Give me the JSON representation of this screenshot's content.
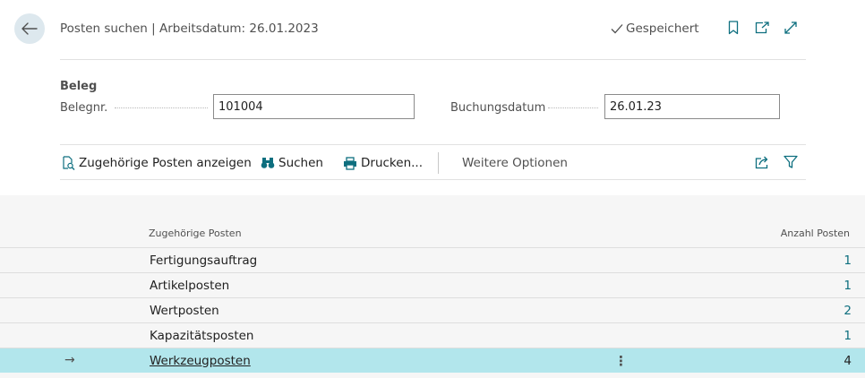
{
  "header": {
    "title": "Posten suchen | Arbeitsdatum: 26.01.2023",
    "saved_label": "Gespeichert",
    "icons": [
      "bookmark-icon",
      "open-new-window-icon",
      "expand-icon"
    ]
  },
  "form": {
    "section_label": "Beleg",
    "belegnr": {
      "label": "Belegnr.",
      "value": "101004"
    },
    "buchungsdatum": {
      "label": "Buchungsdatum",
      "value": "26.01.23"
    }
  },
  "actions": {
    "show_related": "Zugehörige Posten anzeigen",
    "search": "Suchen",
    "print": "Drucken...",
    "more_options": "Weitere Optionen"
  },
  "table": {
    "columns": {
      "related": "Zugehörige Posten",
      "count": "Anzahl Posten"
    },
    "rows": [
      {
        "name": "Fertigungsauftrag",
        "count": "1"
      },
      {
        "name": "Artikelposten",
        "count": "1"
      },
      {
        "name": "Wertposten",
        "count": "2"
      },
      {
        "name": "Kapazitätsposten",
        "count": "1"
      },
      {
        "name": "Werkzeugposten",
        "count": "4",
        "selected": true
      }
    ]
  },
  "colors": {
    "accent": "#0e6f7f",
    "selected_row": "#b2e6ec",
    "back_button_bg": "#dde8ee"
  }
}
